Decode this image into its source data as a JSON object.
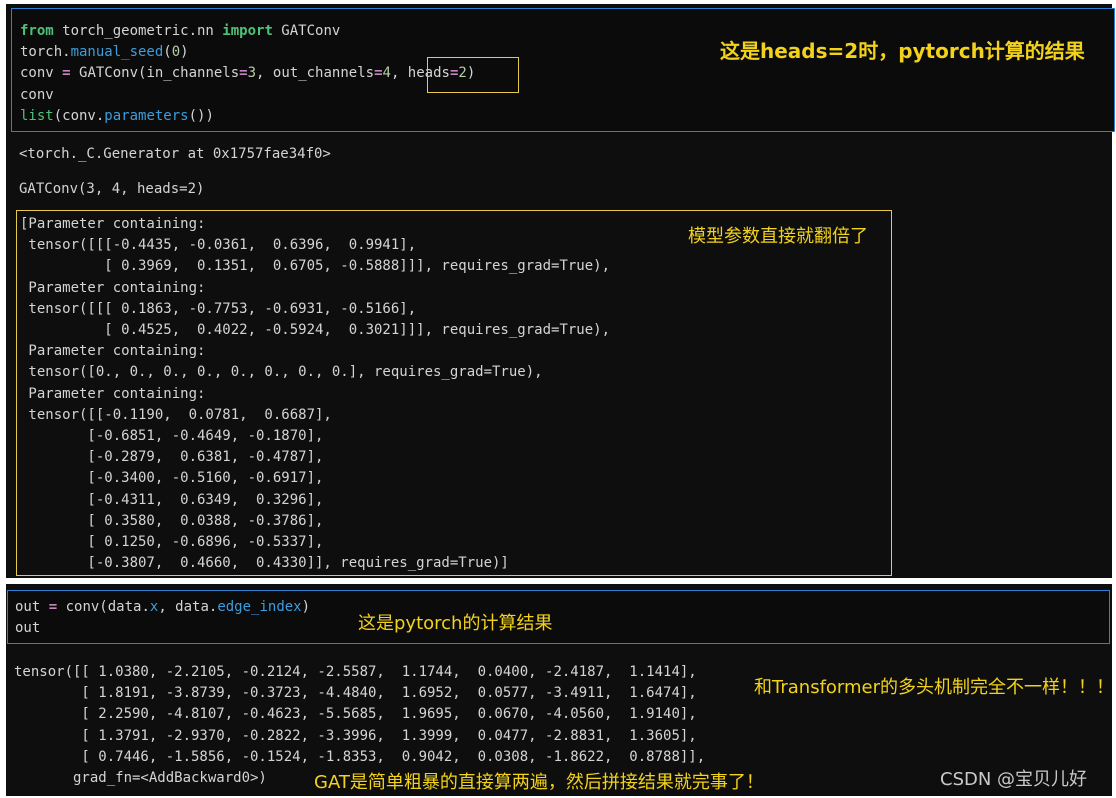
{
  "cell1": {
    "line1_from": "from",
    "line1_module": " torch_geometric.nn ",
    "line1_import": "import",
    "line1_name": " GATConv",
    "line2_obj": "torch.",
    "line2_fn": "manual_seed",
    "line2_open": "(",
    "line2_arg": "0",
    "line2_close": ")",
    "line3_lhs": "conv ",
    "line3_eq": "=",
    "line3_call": " GATConv(in_channels",
    "line3_eq2": "=",
    "line3_v1": "3",
    "line3_mid": ", out_channels",
    "line3_eq3": "=",
    "line3_v2": "4",
    "line3_sep": ", heads",
    "line3_eq4": "=",
    "line3_v3": "2",
    "line3_end": ")",
    "line4": "conv",
    "line5_list": "list",
    "line5_a": "(conv.",
    "line5_fn": "parameters",
    "line5_b": "())"
  },
  "output1": {
    "generator": "<torch._C.Generator at 0x1757fae34f0>",
    "repr": "GATConv(3, 4, heads=2)",
    "params": "[Parameter containing:\n tensor([[[-0.4435, -0.0361,  0.6396,  0.9941],\n          [ 0.3969,  0.1351,  0.6705, -0.5888]]], requires_grad=True),\n Parameter containing:\n tensor([[[ 0.1863, -0.7753, -0.6931, -0.5166],\n          [ 0.4525,  0.4022, -0.5924,  0.3021]]], requires_grad=True),\n Parameter containing:\n tensor([0., 0., 0., 0., 0., 0., 0., 0.], requires_grad=True),\n Parameter containing:\n tensor([[-0.1190,  0.0781,  0.6687],\n        [-0.6851, -0.4649, -0.1870],\n        [-0.2879,  0.6381, -0.4787],\n        [-0.3400, -0.5160, -0.6917],\n        [-0.4311,  0.6349,  0.3296],\n        [ 0.3580,  0.0388, -0.3786],\n        [ 0.1250, -0.6896, -0.5337],\n        [-0.3807,  0.4660,  0.4330]], requires_grad=True)]"
  },
  "cell2": {
    "line1_a": "out ",
    "line1_eq": "=",
    "line1_b": " conv(data.",
    "line1_x": "x",
    "line1_c": ", data.",
    "line1_ei": "edge_index",
    "line1_d": ")",
    "line2": "out"
  },
  "output2": {
    "tensor": "tensor([[ 1.0380, -2.2105, -0.2124, -2.5587,  1.1744,  0.0400, -2.4187,  1.1414],\n        [ 1.8191, -3.8739, -0.3723, -4.4840,  1.6952,  0.0577, -3.4911,  1.6474],\n        [ 2.2590, -4.8107, -0.4623, -5.5685,  1.9695,  0.0670, -4.0560,  1.9140],\n        [ 1.3791, -2.9370, -0.2822, -3.3996,  1.3999,  0.0477, -2.8831,  1.3605],\n        [ 0.7446, -1.5856, -0.1524, -1.8353,  0.9042,  0.0308, -1.8622,  0.8788]],\n       grad_fn=<AddBackward0>)"
  },
  "annotations": {
    "heads_result": "这是heads=2时，pytorch计算的结果",
    "params_doubled": "模型参数直接就翻倍了",
    "pytorch_result": "这是pytorch的计算结果",
    "not_transformer": "和Transformer的多头机制完全不一样！！！",
    "gat_repeat": "GAT是简单粗暴的直接算两遍，然后拼接结果就完事了！"
  },
  "watermark": "CSDN @宝贝儿好",
  "colors": {
    "annotation": "#f2d21b",
    "cell_border": "#2d7fd4",
    "highlight_box": "#e6c84a",
    "keyword": "#4fc27a",
    "function": "#3c9ddd",
    "number": "#b5cea8"
  }
}
